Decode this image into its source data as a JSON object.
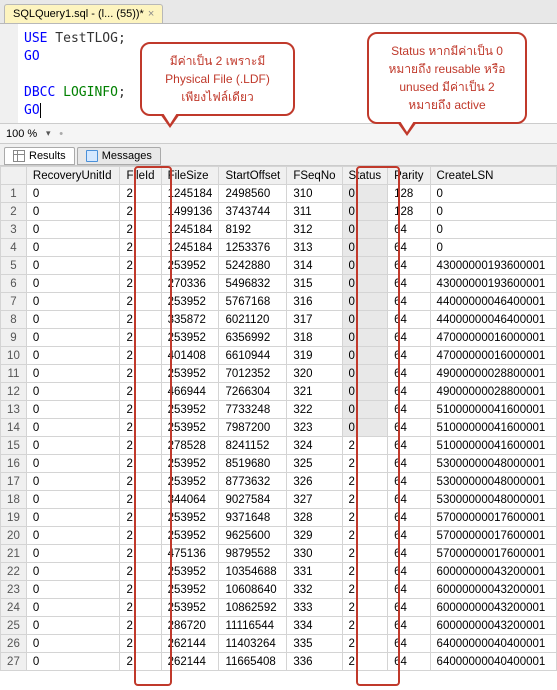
{
  "tab": {
    "title": "SQLQuery1.sql - (l... (55))*"
  },
  "editor": {
    "line1_kw": "USE",
    "line1_db": " TestTLOG",
    "line1_end": ";",
    "line2": "GO",
    "line4_kw": "DBCC",
    "line4_cmd": " LOGINFO",
    "line4_end": ";",
    "line5": "GO"
  },
  "zoom": {
    "value": "100 %"
  },
  "resultTabs": {
    "results": "Results",
    "messages": "Messages"
  },
  "columns": [
    "RecoveryUnitId",
    "FileId",
    "FileSize",
    "StartOffset",
    "FSeqNo",
    "Status",
    "Parity",
    "CreateLSN"
  ],
  "rows": [
    {
      "n": 1,
      "ru": "0",
      "fid": "2",
      "fs": "1245184",
      "so": "2498560",
      "fsn": "310",
      "st": "0",
      "pa": "128",
      "cl": "0"
    },
    {
      "n": 2,
      "ru": "0",
      "fid": "2",
      "fs": "1499136",
      "so": "3743744",
      "fsn": "311",
      "st": "0",
      "pa": "128",
      "cl": "0"
    },
    {
      "n": 3,
      "ru": "0",
      "fid": "2",
      "fs": "1245184",
      "so": "8192",
      "fsn": "312",
      "st": "0",
      "pa": "64",
      "cl": "0"
    },
    {
      "n": 4,
      "ru": "0",
      "fid": "2",
      "fs": "1245184",
      "so": "1253376",
      "fsn": "313",
      "st": "0",
      "pa": "64",
      "cl": "0"
    },
    {
      "n": 5,
      "ru": "0",
      "fid": "2",
      "fs": "253952",
      "so": "5242880",
      "fsn": "314",
      "st": "0",
      "pa": "64",
      "cl": "43000000193600001"
    },
    {
      "n": 6,
      "ru": "0",
      "fid": "2",
      "fs": "270336",
      "so": "5496832",
      "fsn": "315",
      "st": "0",
      "pa": "64",
      "cl": "43000000193600001"
    },
    {
      "n": 7,
      "ru": "0",
      "fid": "2",
      "fs": "253952",
      "so": "5767168",
      "fsn": "316",
      "st": "0",
      "pa": "64",
      "cl": "44000000046400001"
    },
    {
      "n": 8,
      "ru": "0",
      "fid": "2",
      "fs": "335872",
      "so": "6021120",
      "fsn": "317",
      "st": "0",
      "pa": "64",
      "cl": "44000000046400001"
    },
    {
      "n": 9,
      "ru": "0",
      "fid": "2",
      "fs": "253952",
      "so": "6356992",
      "fsn": "318",
      "st": "0",
      "pa": "64",
      "cl": "47000000016000001"
    },
    {
      "n": 10,
      "ru": "0",
      "fid": "2",
      "fs": "401408",
      "so": "6610944",
      "fsn": "319",
      "st": "0",
      "pa": "64",
      "cl": "47000000016000001"
    },
    {
      "n": 11,
      "ru": "0",
      "fid": "2",
      "fs": "253952",
      "so": "7012352",
      "fsn": "320",
      "st": "0",
      "pa": "64",
      "cl": "49000000028800001"
    },
    {
      "n": 12,
      "ru": "0",
      "fid": "2",
      "fs": "466944",
      "so": "7266304",
      "fsn": "321",
      "st": "0",
      "pa": "64",
      "cl": "49000000028800001"
    },
    {
      "n": 13,
      "ru": "0",
      "fid": "2",
      "fs": "253952",
      "so": "7733248",
      "fsn": "322",
      "st": "0",
      "pa": "64",
      "cl": "51000000041600001"
    },
    {
      "n": 14,
      "ru": "0",
      "fid": "2",
      "fs": "253952",
      "so": "7987200",
      "fsn": "323",
      "st": "0",
      "pa": "64",
      "cl": "51000000041600001"
    },
    {
      "n": 15,
      "ru": "0",
      "fid": "2",
      "fs": "278528",
      "so": "8241152",
      "fsn": "324",
      "st": "2",
      "pa": "64",
      "cl": "51000000041600001"
    },
    {
      "n": 16,
      "ru": "0",
      "fid": "2",
      "fs": "253952",
      "so": "8519680",
      "fsn": "325",
      "st": "2",
      "pa": "64",
      "cl": "53000000048000001"
    },
    {
      "n": 17,
      "ru": "0",
      "fid": "2",
      "fs": "253952",
      "so": "8773632",
      "fsn": "326",
      "st": "2",
      "pa": "64",
      "cl": "53000000048000001"
    },
    {
      "n": 18,
      "ru": "0",
      "fid": "2",
      "fs": "344064",
      "so": "9027584",
      "fsn": "327",
      "st": "2",
      "pa": "64",
      "cl": "53000000048000001"
    },
    {
      "n": 19,
      "ru": "0",
      "fid": "2",
      "fs": "253952",
      "so": "9371648",
      "fsn": "328",
      "st": "2",
      "pa": "64",
      "cl": "57000000017600001"
    },
    {
      "n": 20,
      "ru": "0",
      "fid": "2",
      "fs": "253952",
      "so": "9625600",
      "fsn": "329",
      "st": "2",
      "pa": "64",
      "cl": "57000000017600001"
    },
    {
      "n": 21,
      "ru": "0",
      "fid": "2",
      "fs": "475136",
      "so": "9879552",
      "fsn": "330",
      "st": "2",
      "pa": "64",
      "cl": "57000000017600001"
    },
    {
      "n": 22,
      "ru": "0",
      "fid": "2",
      "fs": "253952",
      "so": "10354688",
      "fsn": "331",
      "st": "2",
      "pa": "64",
      "cl": "60000000043200001"
    },
    {
      "n": 23,
      "ru": "0",
      "fid": "2",
      "fs": "253952",
      "so": "10608640",
      "fsn": "332",
      "st": "2",
      "pa": "64",
      "cl": "60000000043200001"
    },
    {
      "n": 24,
      "ru": "0",
      "fid": "2",
      "fs": "253952",
      "so": "10862592",
      "fsn": "333",
      "st": "2",
      "pa": "64",
      "cl": "60000000043200001"
    },
    {
      "n": 25,
      "ru": "0",
      "fid": "2",
      "fs": "286720",
      "so": "11116544",
      "fsn": "334",
      "st": "2",
      "pa": "64",
      "cl": "60000000043200001"
    },
    {
      "n": 26,
      "ru": "0",
      "fid": "2",
      "fs": "262144",
      "so": "11403264",
      "fsn": "335",
      "st": "2",
      "pa": "64",
      "cl": "64000000040400001"
    },
    {
      "n": 27,
      "ru": "0",
      "fid": "2",
      "fs": "262144",
      "so": "11665408",
      "fsn": "336",
      "st": "2",
      "pa": "64",
      "cl": "64000000040400001"
    }
  ],
  "annotations": {
    "fileId": "มีค่าเป็น 2 เพราะมี\nPhysical File (.LDF)\nเพียงไฟล์เดียว",
    "status": "Status หากมีค่าเป็น 0\nหมายถึง reusable หรือ\nunused มีค่าเป็น 2\nหมายถึง active"
  }
}
